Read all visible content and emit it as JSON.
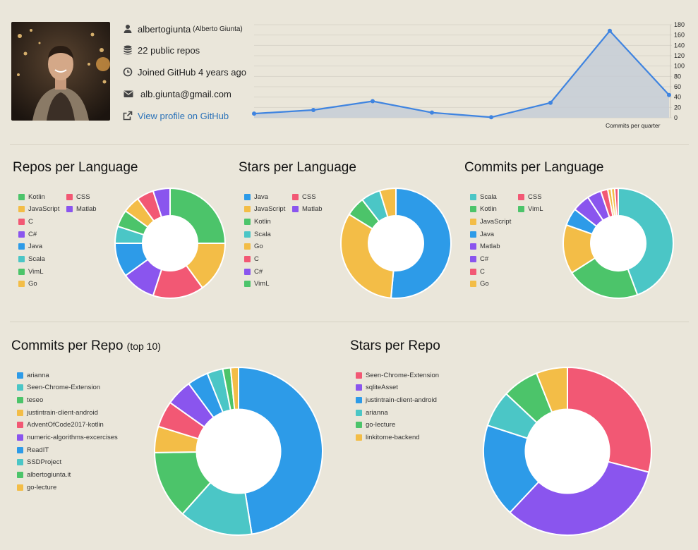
{
  "profile": {
    "username": "albertogiunta",
    "full_name": "(Alberto Giunta)",
    "public_repos": "22 public repos",
    "joined": "Joined GitHub 4 years ago",
    "email": "alb.giunta@gmail.com",
    "profile_link": "View profile on GitHub",
    "icons": [
      "user-icon",
      "database-icon",
      "clock-icon",
      "envelope-icon",
      "external-link-icon"
    ]
  },
  "sections": {
    "repos_per_language": "Repos per Language",
    "stars_per_language": "Stars per Language",
    "commits_per_language": "Commits per Language",
    "commits_per_repo": "Commits per Repo",
    "commits_per_repo_suffix": "(top 10)",
    "stars_per_repo": "Stars per Repo",
    "commits_per_quarter": "Commits per quarter"
  },
  "colors": {
    "blue": "#2d9be8",
    "teal": "#4bc6c6",
    "green": "#4cc46a",
    "yellow": "#f3bd47",
    "red": "#f25874",
    "purple": "#8a55ee",
    "line": "#3f84e0",
    "area": "#c5ccd6"
  },
  "chart_data": [
    {
      "id": "commits_per_quarter",
      "type": "area",
      "title": "Commits per quarter",
      "values": [
        8,
        15,
        32,
        10,
        1,
        29,
        168,
        44
      ],
      "ylim": [
        0,
        180
      ],
      "yticks": [
        0,
        20,
        40,
        60,
        80,
        100,
        120,
        140,
        160,
        180
      ],
      "grid": true
    },
    {
      "id": "repos_per_language",
      "type": "pie",
      "title": "Repos per Language",
      "legend": [
        "Kotlin",
        "CSS",
        "JavaScript",
        "Matlab",
        "C",
        "C#",
        "Java",
        "Scala",
        "VimL",
        "Go"
      ],
      "slices": [
        {
          "label": "Kotlin",
          "value": 5,
          "color": "#4cc46a"
        },
        {
          "label": "JavaScript",
          "value": 3,
          "color": "#f3bd47"
        },
        {
          "label": "CSS",
          "value": 3,
          "color": "#f25874"
        },
        {
          "label": "C#",
          "value": 2,
          "color": "#8a55ee"
        },
        {
          "label": "Java",
          "value": 2,
          "color": "#2d9be8"
        },
        {
          "label": "Scala",
          "value": 1,
          "color": "#4bc6c6"
        },
        {
          "label": "VimL",
          "value": 1,
          "color": "#4cc46a"
        },
        {
          "label": "Go",
          "value": 1,
          "color": "#f3bd47"
        },
        {
          "label": "C",
          "value": 1,
          "color": "#f25874"
        },
        {
          "label": "Matlab",
          "value": 1,
          "color": "#8a55ee"
        }
      ]
    },
    {
      "id": "stars_per_language",
      "type": "pie",
      "title": "Stars per Language",
      "legend": [
        "Java",
        "CSS",
        "JavaScript",
        "Matlab",
        "Kotlin",
        "Scala",
        "Go",
        "C",
        "C#",
        "VimL"
      ],
      "slices": [
        {
          "label": "Java",
          "value": 54,
          "color": "#2d9be8"
        },
        {
          "label": "JavaScript",
          "value": 34,
          "color": "#f3bd47"
        },
        {
          "label": "Kotlin",
          "value": 6,
          "color": "#4cc46a"
        },
        {
          "label": "Scala",
          "value": 6,
          "color": "#4bc6c6"
        },
        {
          "label": "Go",
          "value": 5,
          "color": "#f3bd47"
        }
      ]
    },
    {
      "id": "commits_per_language",
      "type": "pie",
      "title": "Commits per Language",
      "legend": [
        "Scala",
        "CSS",
        "Kotlin",
        "VimL",
        "JavaScript",
        "Java",
        "Matlab",
        "C#",
        "C",
        "Go"
      ],
      "slices": [
        {
          "label": "Scala",
          "value": 43,
          "color": "#4bc6c6"
        },
        {
          "label": "Kotlin",
          "value": 21,
          "color": "#4cc46a"
        },
        {
          "label": "JavaScript",
          "value": 14,
          "color": "#f3bd47"
        },
        {
          "label": "Java",
          "value": 5,
          "color": "#2d9be8"
        },
        {
          "label": "Matlab",
          "value": 5,
          "color": "#8a55ee"
        },
        {
          "label": "C#",
          "value": 4,
          "color": "#8a55ee"
        },
        {
          "label": "C",
          "value": 2,
          "color": "#f25874"
        },
        {
          "label": "Go",
          "value": 1,
          "color": "#f3bd47"
        },
        {
          "label": "CSS",
          "value": 1,
          "color": "#f3bd47"
        },
        {
          "label": "VimL",
          "value": 1,
          "color": "#f25874"
        }
      ]
    },
    {
      "id": "commits_per_repo",
      "type": "pie",
      "title": "Commits per Repo (top 10)",
      "legend": [
        "arianna",
        "Seen-Chrome-Extension",
        "teseo",
        "justintrain-client-android",
        "AdventOfCode2017-kotlin",
        "numeric-algorithms-excercises",
        "ReadIT",
        "SSDProject",
        "albertogiunta.it",
        "go-lecture"
      ],
      "slices": [
        {
          "label": "arianna",
          "value": 47,
          "color": "#2d9be8"
        },
        {
          "label": "Seen-Chrome-Extension",
          "value": 14,
          "color": "#4bc6c6"
        },
        {
          "label": "teseo",
          "value": 13,
          "color": "#4cc46a"
        },
        {
          "label": "justintrain-client-android",
          "value": 5,
          "color": "#f3bd47"
        },
        {
          "label": "AdventOfCode2017-kotlin",
          "value": 5,
          "color": "#f25874"
        },
        {
          "label": "numeric-algorithms-excercises",
          "value": 5,
          "color": "#8a55ee"
        },
        {
          "label": "ReadIT",
          "value": 4,
          "color": "#2d9be8"
        },
        {
          "label": "SSDProject",
          "value": 3,
          "color": "#4bc6c6"
        },
        {
          "label": "albertogiunta.it",
          "value": 1.5,
          "color": "#4cc46a"
        },
        {
          "label": "go-lecture",
          "value": 1.5,
          "color": "#f3bd47"
        }
      ]
    },
    {
      "id": "stars_per_repo",
      "type": "pie",
      "title": "Stars per Repo",
      "legend": [
        "Seen-Chrome-Extension",
        "sqliteAsset",
        "justintrain-client-android",
        "arianna",
        "go-lecture",
        "linkitome-backend"
      ],
      "slices": [
        {
          "label": "Seen-Chrome-Extension",
          "value": 29,
          "color": "#f25874"
        },
        {
          "label": "sqliteAsset",
          "value": 33,
          "color": "#8a55ee"
        },
        {
          "label": "justintrain-client-android",
          "value": 18,
          "color": "#2d9be8"
        },
        {
          "label": "arianna",
          "value": 7,
          "color": "#4bc6c6"
        },
        {
          "label": "go-lecture",
          "value": 7,
          "color": "#4cc46a"
        },
        {
          "label": "linkitome-backend",
          "value": 6,
          "color": "#f3bd47"
        }
      ]
    }
  ]
}
